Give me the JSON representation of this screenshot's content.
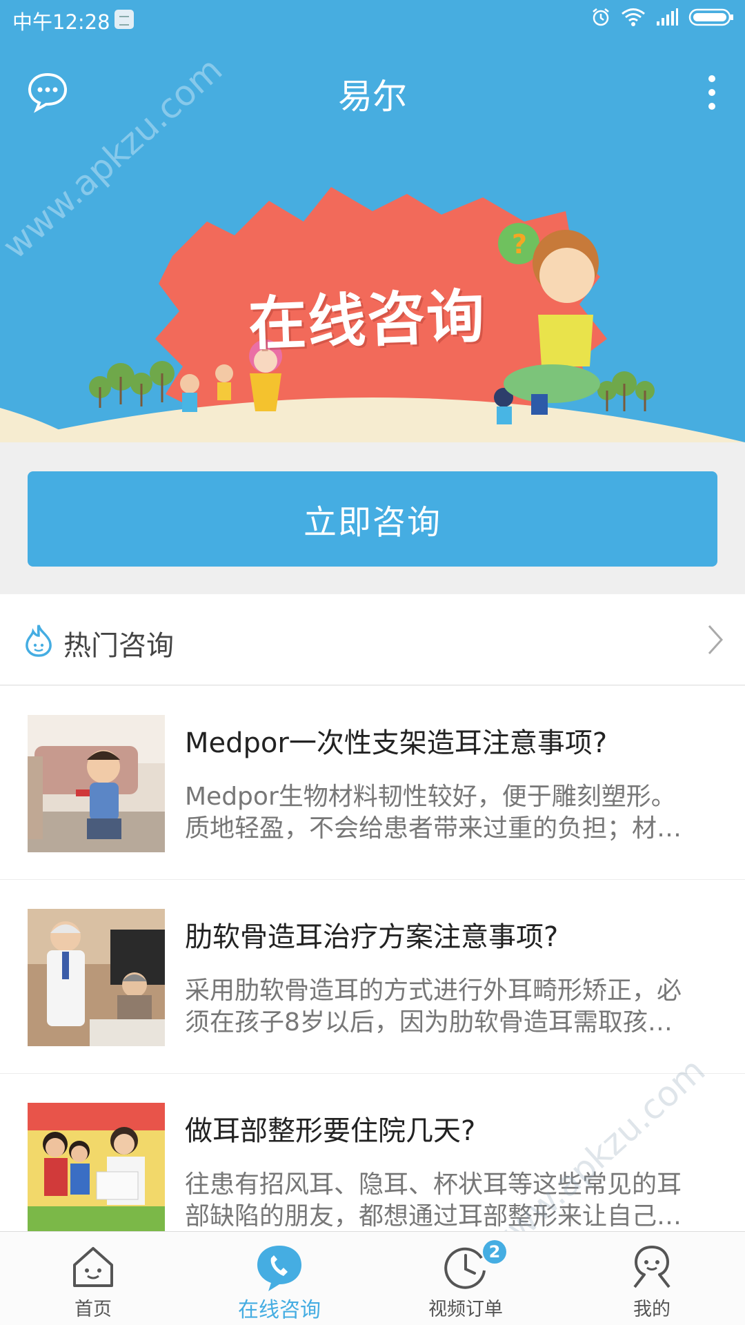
{
  "status_bar": {
    "time": "中午12:28"
  },
  "app_bar": {
    "title": "易尔"
  },
  "banner": {
    "text": "在线咨询"
  },
  "consult_button": {
    "label": "立即咨询"
  },
  "hot_section": {
    "title": "热门咨询"
  },
  "articles": [
    {
      "title": "Medpor一次性支架造耳注意事项?",
      "desc_line1": "Medpor生物材料韧性较好，便于雕刻塑形。",
      "desc_line2": "质地轻盈，不会给患者带来过重的负担；材…"
    },
    {
      "title": "肋软骨造耳治疗方案注意事项?",
      "desc_line1": "采用肋软骨造耳的方式进行外耳畸形矫正，必",
      "desc_line2": "须在孩子8岁以后，因为肋软骨造耳需取孩…"
    },
    {
      "title": "做耳部整形要住院几天?",
      "desc_line1": "往患有招风耳、隐耳、杯状耳等这些常见的耳",
      "desc_line2": "部缺陷的朋友，都想通过耳部整形来让自己…"
    }
  ],
  "bottom_nav": {
    "items": [
      {
        "label": "首页",
        "icon": "home-icon"
      },
      {
        "label": "在线咨询",
        "icon": "consult-icon"
      },
      {
        "label": "视频订单",
        "icon": "clock-icon",
        "badge": "2"
      },
      {
        "label": "我的",
        "icon": "profile-icon"
      }
    ],
    "active_index": 1
  },
  "watermark": "www.apkzu.com",
  "colors": {
    "primary": "#47ade0",
    "banner_burst": "#f26a5a",
    "ground": "#f6ecd0"
  }
}
